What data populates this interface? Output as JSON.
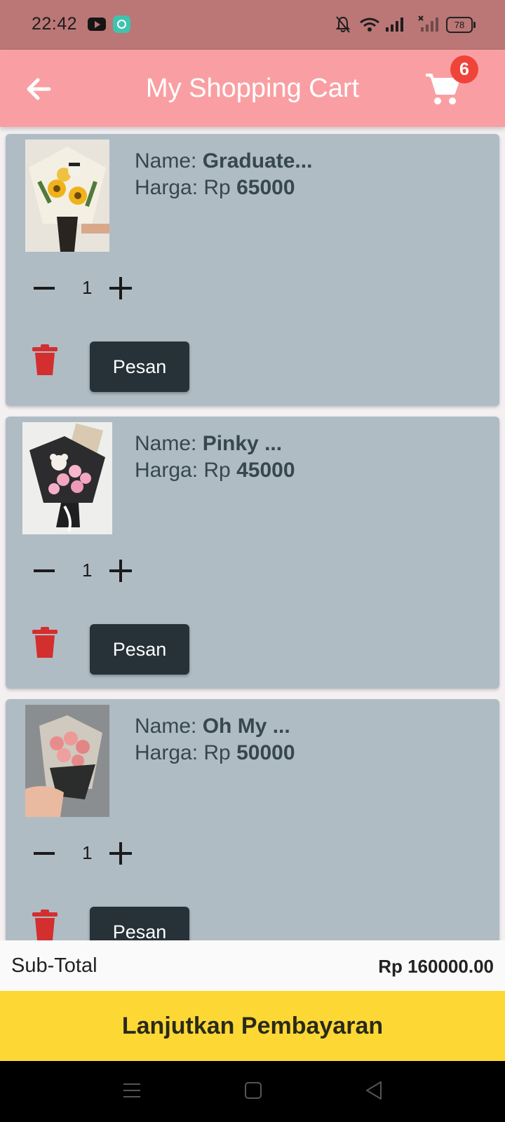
{
  "status_bar": {
    "time": "22:42",
    "battery": "78"
  },
  "app_bar": {
    "title": "My Shopping Cart",
    "cart_count": "6"
  },
  "items": [
    {
      "name_label": "Name: ",
      "name": "Graduate...",
      "price_label": "Harga: Rp ",
      "price": "65000",
      "qty": "1",
      "order_label": "Pesan"
    },
    {
      "name_label": "Name: ",
      "name": "Pinky ...",
      "price_label": "Harga: Rp ",
      "price": "45000",
      "qty": "1",
      "order_label": "Pesan"
    },
    {
      "name_label": "Name: ",
      "name": "Oh My ...",
      "price_label": "Harga: Rp ",
      "price": "50000",
      "qty": "1",
      "order_label": "Pesan"
    }
  ],
  "subtotal": {
    "label": "Sub-Total",
    "value": "Rp 160000.00"
  },
  "checkout": {
    "label": "Lanjutkan Pembayaran"
  },
  "colors": {
    "status_bar": "#bb7676",
    "app_bar": "#f99fa3",
    "card": "#b0bcc4",
    "button_dark": "#263238",
    "checkout": "#fdd835",
    "badge": "#f0443a",
    "delete": "#d32f2f"
  }
}
